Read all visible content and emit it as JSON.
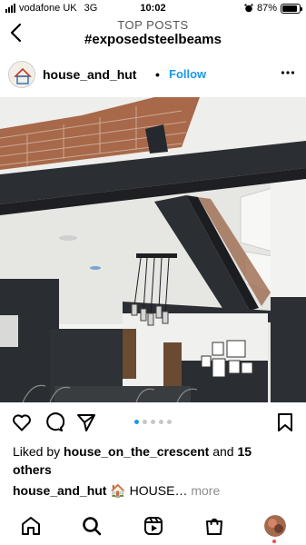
{
  "status_bar": {
    "carrier": "vodafone UK",
    "network": "3G",
    "time": "10:02",
    "battery_percent": "87%",
    "battery_level": 0.87
  },
  "header": {
    "subtitle": "TOP POSTS",
    "title": "#exposedsteelbeams",
    "back_icon": "chevron-left-icon"
  },
  "post": {
    "username": "house_and_hut",
    "separator": "•",
    "follow_label": "Follow",
    "more_icon": "more-horizontal-icon",
    "photo_description_icon": "photo",
    "carousel": {
      "count": 5,
      "active": 1
    },
    "likes_prefix": "Liked by ",
    "likes_user": "house_on_the_crescent",
    "likes_middle": " and ",
    "likes_count": "15",
    "likes_suffix": "others",
    "caption_user": "house_and_hut",
    "caption_text": " 🏠 HOUSE…",
    "caption_more": " more"
  },
  "nav": {
    "items": [
      "home-icon",
      "search-icon",
      "reels-icon",
      "shop-icon",
      "profile-avatar"
    ]
  },
  "colors": {
    "accent": "#1c96e8",
    "notification": "#ed4956"
  }
}
